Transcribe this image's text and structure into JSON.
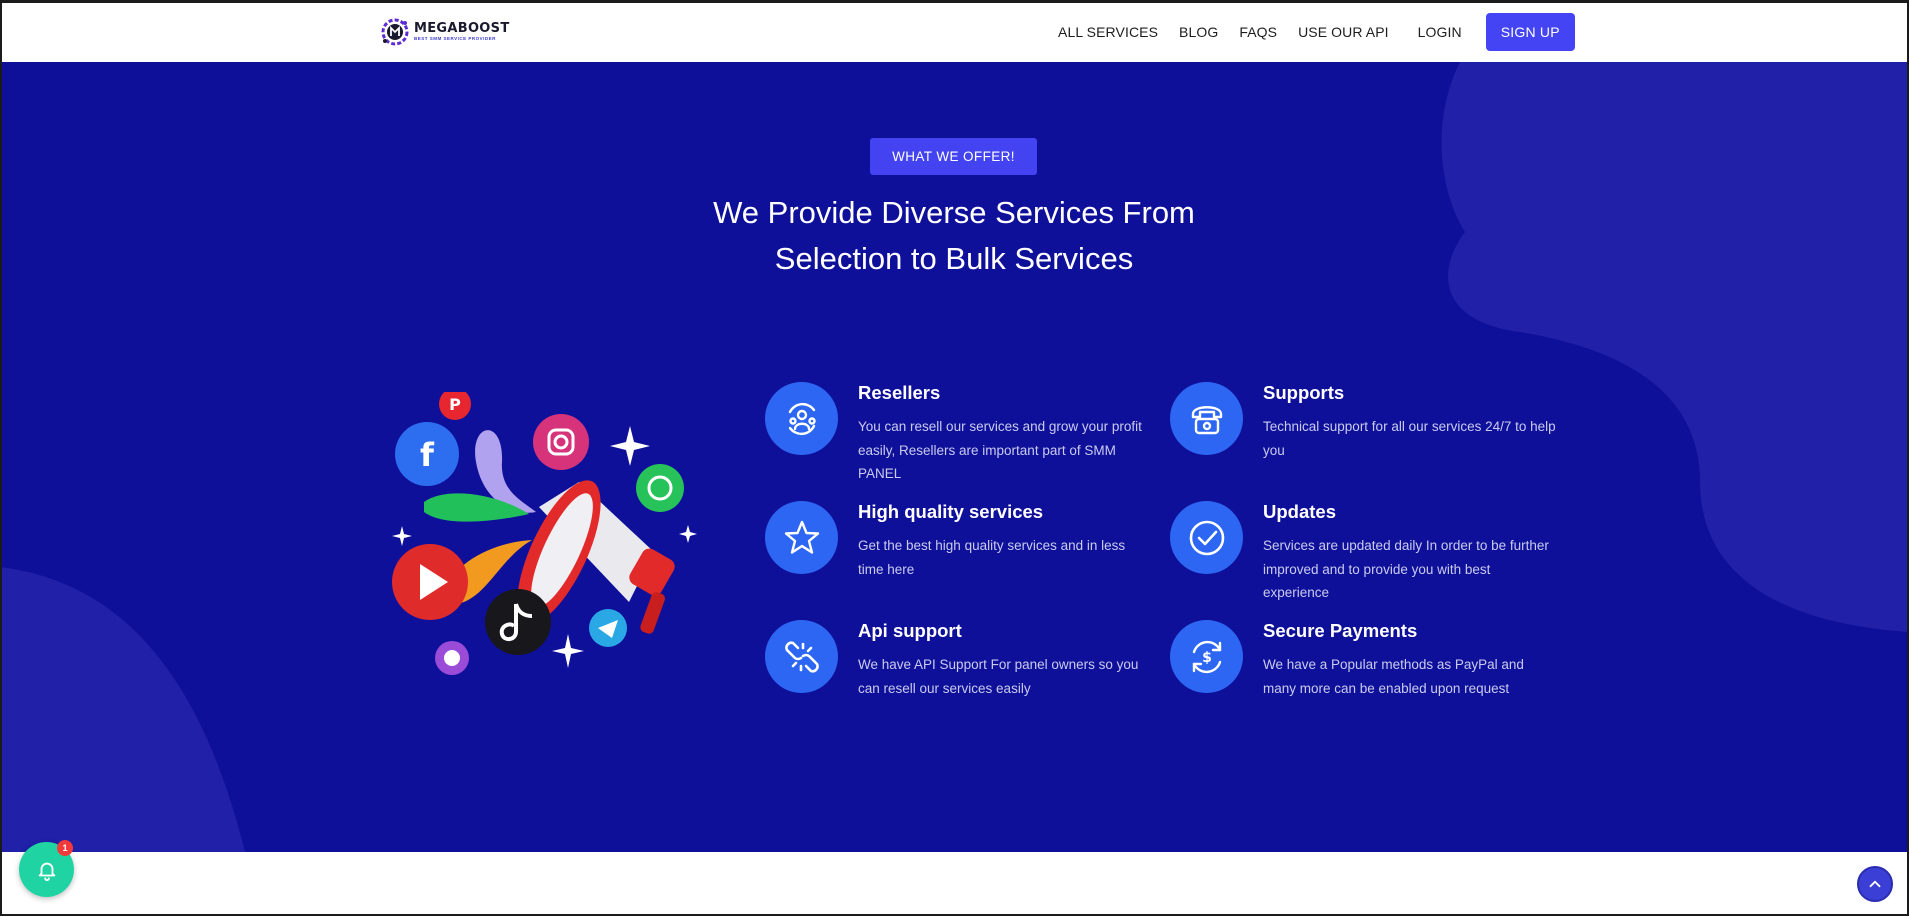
{
  "brand": {
    "name": "MEGABOOST",
    "tagline": "BEST SMM SERVICE PROVIDER"
  },
  "nav": {
    "items": [
      "ALL SERVICES",
      "BLOG",
      "FAQS",
      "USE OUR API"
    ],
    "login": "LOGIN",
    "signup": "SIGN UP"
  },
  "hero": {
    "badge": "WHAT WE OFFER!",
    "title_line1": "We Provide Diverse Services From",
    "title_line2": "Selection to Bulk Services"
  },
  "features": [
    {
      "title": "Resellers",
      "desc": "You can resell our services and grow your profit easily, Resellers are important part of SMM PANEL",
      "icon": "reseller-icon"
    },
    {
      "title": "Supports",
      "desc": "Technical support for all our services 24/7 to help you",
      "icon": "telephone-icon"
    },
    {
      "title": "High quality services",
      "desc": "Get the best high quality services and in less time here",
      "icon": "star-icon"
    },
    {
      "title": "Updates",
      "desc": "Services are updated daily In order to be further improved and to provide you with best experience",
      "icon": "check-circle-icon"
    },
    {
      "title": "Api support",
      "desc": "We have API Support For panel owners so you can resell our services easily",
      "icon": "broken-link-icon"
    },
    {
      "title": "Secure Payments",
      "desc": "We have a Popular methods as PayPal and many more can be enabled upon request",
      "icon": "payment-cycle-icon"
    }
  ],
  "notifications": {
    "count": "1"
  },
  "colors": {
    "hero_bg": "#0f109a",
    "accent": "#4444f5",
    "icon_circle": "#2c66f2",
    "notify": "#1fd4a2"
  }
}
